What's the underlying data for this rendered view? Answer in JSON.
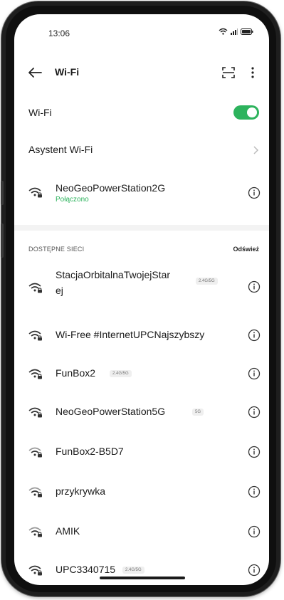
{
  "status_bar": {
    "time": "13:06",
    "icons": [
      "wifi-icon",
      "signal-icon",
      "battery-icon"
    ]
  },
  "app_bar": {
    "title": "Wi-Fi",
    "back_icon": "arrow-left-icon",
    "scan_icon": "qr-scan-icon",
    "menu_icon": "more-vertical-icon"
  },
  "wifi_toggle": {
    "label": "Wi-Fi",
    "on": true
  },
  "assistant": {
    "label": "Asystent Wi-Fi"
  },
  "connected": {
    "name": "NeoGeoPowerStation2G",
    "status": "Połączono"
  },
  "available": {
    "section_title": "DOSTĘPNE SIECI",
    "refresh_label": "Odśwież",
    "networks": [
      {
        "name_line1": "StacjaOrbitalnaTwojejStar",
        "name_line2": "ej",
        "badge": "2.4G/5G"
      },
      {
        "name_line1": "Wi-Free #InternetUPCNajszybszy",
        "badge": ""
      },
      {
        "name_line1": "FunBox2",
        "badge": "2.4G/5G"
      },
      {
        "name_line1": "NeoGeoPowerStation5G",
        "badge": "5G"
      },
      {
        "name_line1": "FunBox2-B5D7",
        "badge": ""
      },
      {
        "name_line1": "przykrywka",
        "badge": ""
      },
      {
        "name_line1": "AMIK",
        "badge": ""
      },
      {
        "name_line1": "UPC3340715",
        "badge": "2.4G/5G"
      }
    ]
  },
  "colors": {
    "accent": "#2db35d",
    "text": "#1a1a1a",
    "frame": "#1e1e1e"
  }
}
